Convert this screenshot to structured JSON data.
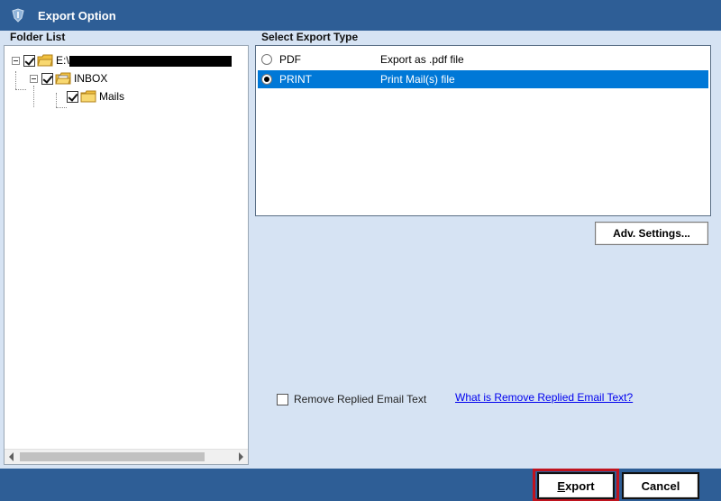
{
  "window": {
    "title": "Export Option"
  },
  "folder_list": {
    "label": "Folder List",
    "root": {
      "prefix": "E:\\"
    },
    "inbox": {
      "label": "INBOX"
    },
    "mails": {
      "label": "Mails"
    }
  },
  "export_type": {
    "label": "Select Export Type",
    "options": [
      {
        "name": "PDF",
        "description": "Export as .pdf file",
        "selected": false
      },
      {
        "name": "PRINT",
        "description": "Print Mail(s) file",
        "selected": true
      }
    ]
  },
  "adv_settings": {
    "label": "Adv. Settings..."
  },
  "remove_replied": {
    "label": "Remove Replied Email Text",
    "checked": false
  },
  "help_link": {
    "label": "What is Remove Replied Email Text?"
  },
  "footer": {
    "export": {
      "accel": "E",
      "rest": "xport"
    },
    "cancel": {
      "label": "Cancel"
    }
  },
  "colors": {
    "titlebar": "#2e5e96",
    "selection": "#0078d7",
    "highlight": "#c0141f"
  }
}
